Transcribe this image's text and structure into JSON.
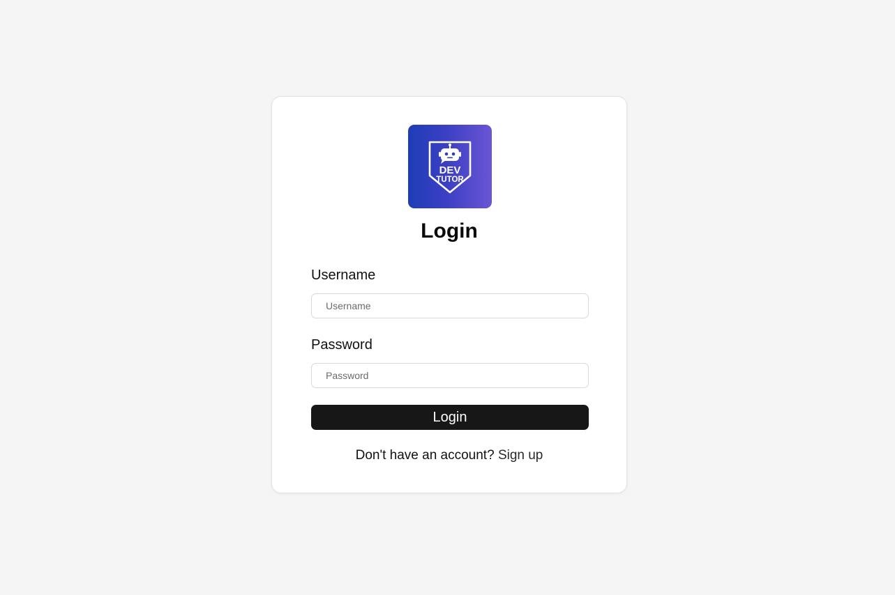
{
  "logo": {
    "icon": "robot-shield-logo",
    "line1": "DEV",
    "line2": "TUTOR",
    "gradient_start": "#1e3db6",
    "gradient_end": "#6a55d4"
  },
  "form": {
    "title": "Login",
    "username_label": "Username",
    "username_placeholder": "Username",
    "username_value": "",
    "password_label": "Password",
    "password_placeholder": "Password",
    "password_value": "",
    "submit_label": "Login"
  },
  "signup": {
    "prompt": "Don't have an account?",
    "link_label": "Sign up"
  },
  "colors": {
    "background": "#f5f5f5",
    "card": "#ffffff",
    "button": "#171717",
    "button_text": "#ffffff"
  }
}
